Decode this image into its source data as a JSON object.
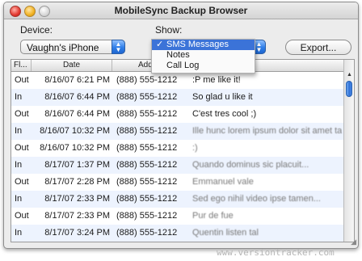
{
  "window": {
    "title": "MobileSync Backup Browser"
  },
  "device": {
    "label": "Device:",
    "selected": "Vaughn's iPhone"
  },
  "show": {
    "label": "Show:",
    "options": [
      {
        "label": "SMS Messages",
        "selected": true
      },
      {
        "label": "Notes",
        "selected": false
      },
      {
        "label": "Call Log",
        "selected": false
      }
    ]
  },
  "export_label": "Export...",
  "table": {
    "columns": [
      "Fl...",
      "Date",
      "Addr"
    ],
    "rows": [
      {
        "dir": "Out",
        "date": "8/16/07 6:21 PM",
        "address": "(888) 555-1212",
        "message": ":P me like it!"
      },
      {
        "dir": "In",
        "date": "8/16/07 6:44 PM",
        "address": "(888) 555-1212",
        "message": "So glad u like it"
      },
      {
        "dir": "Out",
        "date": "8/16/07 6:44 PM",
        "address": "(888) 555-1212",
        "message": "C'est tres cool ;)"
      },
      {
        "dir": "In",
        "date": "8/16/07 10:32 PM",
        "address": "(888) 555-1212",
        "message": "Ille hunc lorem ipsum dolor sit amet tamen..."
      },
      {
        "dir": "Out",
        "date": "8/16/07 10:32 PM",
        "address": "(888) 555-1212",
        "message": ":)"
      },
      {
        "dir": "In",
        "date": "8/17/07 1:37 PM",
        "address": "(888) 555-1212",
        "message": "Quando dominus sic placuit..."
      },
      {
        "dir": "Out",
        "date": "8/17/07 2:28 PM",
        "address": "(888) 555-1212",
        "message": "Emmanuel vale"
      },
      {
        "dir": "In",
        "date": "8/17/07 2:33 PM",
        "address": "(888) 555-1212",
        "message": "Sed ego nihil video ipse tamen..."
      },
      {
        "dir": "Out",
        "date": "8/17/07 2:33 PM",
        "address": "(888) 555-1212",
        "message": "Pur de fue"
      },
      {
        "dir": "In",
        "date": "8/17/07 3:24 PM",
        "address": "(888) 555-1212",
        "message": "Quentin listen tal"
      }
    ]
  },
  "watermark": "www.versiontracker.com"
}
